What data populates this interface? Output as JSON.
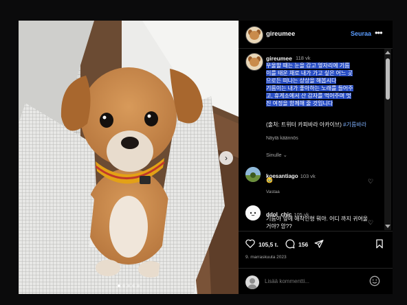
{
  "post": {
    "username": "gireumee",
    "follow_label": "Seuraa",
    "more_icon": "more-horizontal-icon",
    "caption": {
      "time": "118 vk",
      "lines_highlighted": [
        "우울할 때는 눈을 감고 옆자리에 기름",
        "이를 태운 채로 내가 가고 싶은 어느 곳",
        "으로든 떠나는 상상을 해봅시다",
        "기름이는 내가 좋아하는 노래를 들어주",
        "고, 휴게소에서 산 감자를 먹어주며 멋",
        "진 여정을 함께해 줄 것입니다"
      ],
      "source": "(출처: 트위터 카피바라 아카이브)",
      "hashtag": "#기름바라",
      "see_translation": "Näytä käännös"
    },
    "sort_label": "Sinulle ⌄",
    "comments": [
      {
        "username": "koesantiago",
        "time": "103 vk",
        "text": "🥹",
        "reply_label": "Vastaa"
      },
      {
        "username": "ddol_chic",
        "time": "105 vk",
        "text": "기름아 옆에 애착인형 뭐야. 어디 까지 귀여울거야? 앙??"
      }
    ],
    "likes": "105,5 t.",
    "comment_count": "156",
    "date": "9. marraskuuta 2023",
    "add_comment_placeholder": "Lisää kommentti...",
    "carousel": {
      "slides": 5,
      "active": 1
    }
  },
  "colors": {
    "accent": "#5b9dff",
    "highlight": "#2a4fc4",
    "background": "#000000"
  }
}
